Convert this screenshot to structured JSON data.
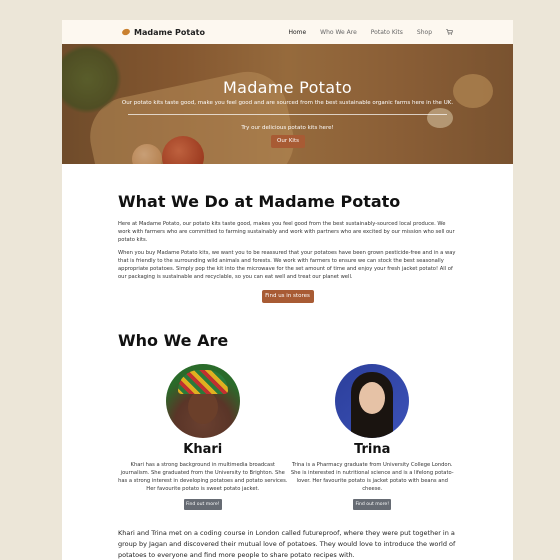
{
  "nav": {
    "brand": "Madame Potato",
    "items": [
      "Home",
      "Who We Are",
      "Potato Kits",
      "Shop"
    ]
  },
  "hero": {
    "title": "Madame Potato",
    "tagline": "Our potato kits taste good, make you feel good and are sourced from the best sustainable organic farms here in the UK.",
    "cta_text": "Try our delicious potato kits here!",
    "cta_button": "Our Kits"
  },
  "what_we_do": {
    "heading": "What We Do at Madame Potato",
    "p1": "Here at Madame Potato, our potato kits taste good, makes you feel good from the best sustainably-sourced local produce. We work with farmers who are committed to farming sustainably and work with partners who are excited by our mission who sell our potato kits.",
    "p2": "When you buy Madame Potato kits, we want you to be reassured that your potatoes have been grown pesticide-free and in a way that is friendly to the surrounding wild animals and forests. We work with farmers to ensure we can stock the best seasonally appropriate potatoes. Simply pop the kit into the microwave for the set amount of time and enjoy your fresh jacket potato! All of our packaging is sustainable and recyclable, so you can eat well and treat our planet well.",
    "button": "Find us in stores"
  },
  "who_we_are": {
    "heading": "Who We Are",
    "people": [
      {
        "name": "Khari",
        "bio": "Khari has a strong background in multimedia broadcast journalism. She graduated from the University to Brighton. She has a strong interest in developing potatoes and potato services. Her favourite potato is sweet potato jacket.",
        "button": "Find out more!"
      },
      {
        "name": "Trina",
        "bio": "Trina is a Pharmacy graduate from University College London. She is interested in nutritional science and is a lifelong potato-lover. Her favourite potato is jacket potato with beans and cheese.",
        "button": "Find out more!"
      }
    ],
    "story": "Khari and Trina met on a coding course in London called futureproof, where they were put together in a group by Jagan and discovered their mutual love of potatoes. They would love to introduce the world of potatoes to everyone and find more people to share potato recipes with."
  },
  "colors": {
    "accent": "#a85b34",
    "nav_bg": "#fdf8f0",
    "page_bg": "#ece6d8"
  },
  "icons": {
    "logo": "potato-logo-icon",
    "cart": "cart-icon"
  }
}
